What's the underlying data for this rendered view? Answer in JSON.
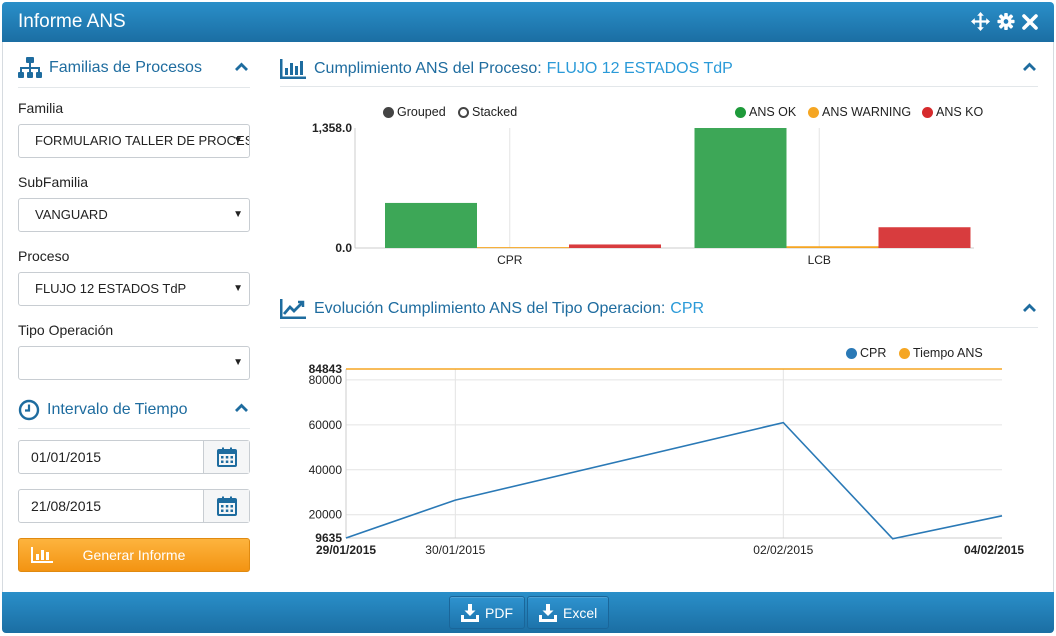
{
  "window": {
    "title": "Informe ANS"
  },
  "sidebar": {
    "familias_title": "Familias de Procesos",
    "fields": [
      {
        "label": "Familia",
        "value": "FORMULARIO TALLER DE PROCESOS"
      },
      {
        "label": "SubFamilia",
        "value": "VANGUARD"
      },
      {
        "label": "Proceso",
        "value": "FLUJO 12 ESTADOS TdP"
      },
      {
        "label": "Tipo Operación",
        "value": ""
      }
    ],
    "intervalo_title": "Intervalo de Tiempo",
    "date_from": "01/01/2015",
    "date_to": "21/08/2015",
    "generate_label": "Generar Informe"
  },
  "bar_panel": {
    "title": "Cumplimiento ANS del Proceso:",
    "highlight": "FLUJO 12 ESTADOS TdP",
    "mode_grouped": "Grouped",
    "mode_stacked": "Stacked"
  },
  "line_panel": {
    "title": "Evolución Cumplimiento ANS del Tipo Operacion:",
    "highlight": "CPR"
  },
  "footer": {
    "pdf_label": "PDF",
    "excel_label": "Excel"
  },
  "colors": {
    "header": "#1f7bb8",
    "accent": "#1e6c9f",
    "ok": "#3da757",
    "warning": "#f5a623",
    "ko": "#d83c3e",
    "line_cpr": "#2a79b6",
    "line_ans": "#f5a623",
    "button": "#f7a11f"
  },
  "chart_data": [
    {
      "type": "bar",
      "categories": [
        "CPR",
        "LCB"
      ],
      "series": [
        {
          "name": "ANS OK",
          "values": [
            510,
            1358
          ]
        },
        {
          "name": "ANS WARNING",
          "values": [
            10,
            20
          ]
        },
        {
          "name": "ANS KO",
          "values": [
            40,
            235
          ]
        }
      ],
      "ytick_labels": [
        "1,358.0",
        "0.0"
      ],
      "ylim": [
        0,
        1358
      ],
      "mode": "Grouped"
    },
    {
      "type": "line",
      "x": [
        "29/01/2015",
        "30/01/2015",
        "02/02/2015",
        "03/02/2015",
        "04/02/2015"
      ],
      "x_tick_labels": [
        "29/01/2015",
        "30/01/2015",
        "02/02/2015",
        "04/02/2015"
      ],
      "series": [
        {
          "name": "CPR",
          "values": [
            9635,
            26500,
            61000,
            9300,
            19500
          ]
        },
        {
          "name": "Tiempo ANS",
          "values": [
            84843,
            84843,
            84843,
            84843,
            84843
          ]
        }
      ],
      "yticks": [
        20000,
        40000,
        60000,
        80000
      ],
      "ymin_label": "9635",
      "ymax_label": "84843",
      "ylim": [
        9635,
        84843
      ]
    }
  ]
}
